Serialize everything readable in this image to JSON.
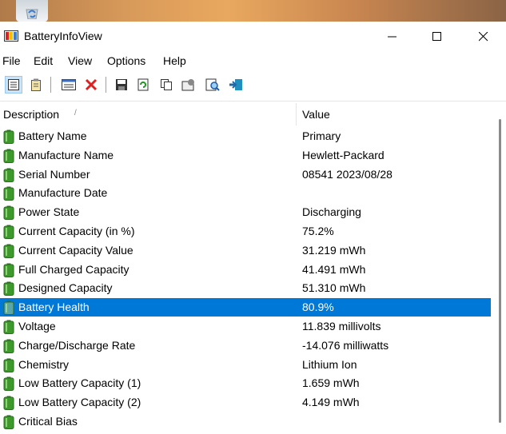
{
  "window": {
    "title": "BatteryInfoView"
  },
  "menu": [
    "File",
    "Edit",
    "View",
    "Options",
    "Help"
  ],
  "list": {
    "columns": {
      "description": "Description",
      "value": "Value"
    },
    "rows": [
      {
        "description": "Battery Name",
        "value": "Primary"
      },
      {
        "description": "Manufacture Name",
        "value": "Hewlett-Packard"
      },
      {
        "description": "Serial Number",
        "value": "08541 2023/08/28"
      },
      {
        "description": "Manufacture Date",
        "value": ""
      },
      {
        "description": "Power State",
        "value": "Discharging"
      },
      {
        "description": "Current Capacity (in %)",
        "value": "75.2%"
      },
      {
        "description": "Current Capacity Value",
        "value": "31.219 mWh"
      },
      {
        "description": "Full Charged Capacity",
        "value": "41.491 mWh"
      },
      {
        "description": "Designed Capacity",
        "value": "51.310 mWh"
      },
      {
        "description": "Battery Health",
        "value": "80.9%"
      },
      {
        "description": "Voltage",
        "value": "11.839 millivolts"
      },
      {
        "description": "Charge/Discharge Rate",
        "value": "-14.076 milliwatts"
      },
      {
        "description": "Chemistry",
        "value": "Lithium Ion"
      },
      {
        "description": "Low Battery Capacity (1)",
        "value": "1.659 mWh"
      },
      {
        "description": "Low Battery Capacity (2)",
        "value": "4.149 mWh"
      },
      {
        "description": "Critical Bias",
        "value": ""
      }
    ],
    "selected_row": "Battery Health"
  },
  "colors": {
    "selection": "#0078d7",
    "battery_icon": "#3c9a2a"
  }
}
